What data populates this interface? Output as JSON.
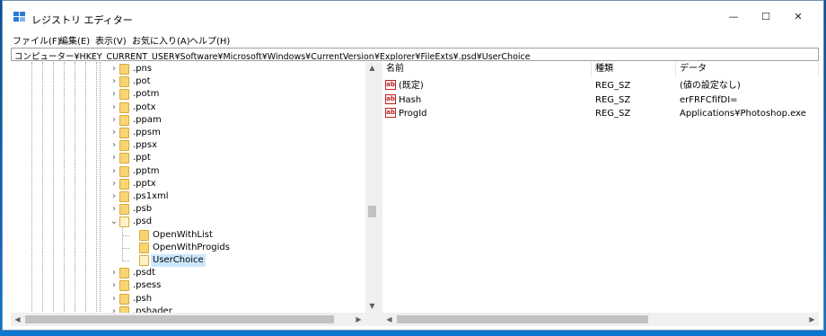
{
  "window": {
    "title": "レジストリ エディター",
    "controls": {
      "minimize": "—",
      "maximize": "☐",
      "close": "✕"
    }
  },
  "menu": [
    "ファイル(F)",
    "編集(E)",
    "表示(V)",
    "お気に入り(A)",
    "ヘルプ(H)"
  ],
  "address": "コンピューター¥HKEY_CURRENT_USER¥Software¥Microsoft¥Windows¥CurrentVersion¥Explorer¥FileExts¥.psd¥UserChoice",
  "tree": {
    "items": [
      {
        "label": ".pns",
        "expanded": false
      },
      {
        "label": ".pot",
        "expanded": false
      },
      {
        "label": ".potm",
        "expanded": false
      },
      {
        "label": ".potx",
        "expanded": false
      },
      {
        "label": ".ppam",
        "expanded": false
      },
      {
        "label": ".ppsm",
        "expanded": false
      },
      {
        "label": ".ppsx",
        "expanded": false
      },
      {
        "label": ".ppt",
        "expanded": false
      },
      {
        "label": ".pptm",
        "expanded": false
      },
      {
        "label": ".pptx",
        "expanded": false
      },
      {
        "label": ".ps1xml",
        "expanded": false
      },
      {
        "label": ".psb",
        "expanded": false
      },
      {
        "label": ".psd",
        "expanded": true
      },
      {
        "label": "OpenWithList",
        "child": true
      },
      {
        "label": "OpenWithProgids",
        "child": true
      },
      {
        "label": "UserChoice",
        "child": true,
        "selected": true
      },
      {
        "label": ".psdt",
        "expanded": false
      },
      {
        "label": ".psess",
        "expanded": false
      },
      {
        "label": ".psh",
        "expanded": false
      },
      {
        "label": ".pshader",
        "expanded": false
      }
    ]
  },
  "list": {
    "columns": [
      "名前",
      "種類",
      "データ"
    ],
    "rows": [
      {
        "name": "(既定)",
        "type": "REG_SZ",
        "data": "(値の設定なし)"
      },
      {
        "name": "Hash",
        "type": "REG_SZ",
        "data": "erFRFCfifDI="
      },
      {
        "name": "ProgId",
        "type": "REG_SZ",
        "data": "Applications¥Photoshop.exe"
      }
    ]
  },
  "icons": {
    "app": "regedit-icon",
    "value": "string-value-icon",
    "value_glyph": "ab",
    "folder": "folder-icon",
    "expand_glyph": "›",
    "collapse_glyph": "⌄",
    "scroll_up": "▲",
    "scroll_down": "▼",
    "scroll_left": "◀",
    "scroll_right": "▶"
  },
  "colors": {
    "selection": "#cce8ff",
    "folder": "#f8d572",
    "desktop": "#0a63b8"
  }
}
